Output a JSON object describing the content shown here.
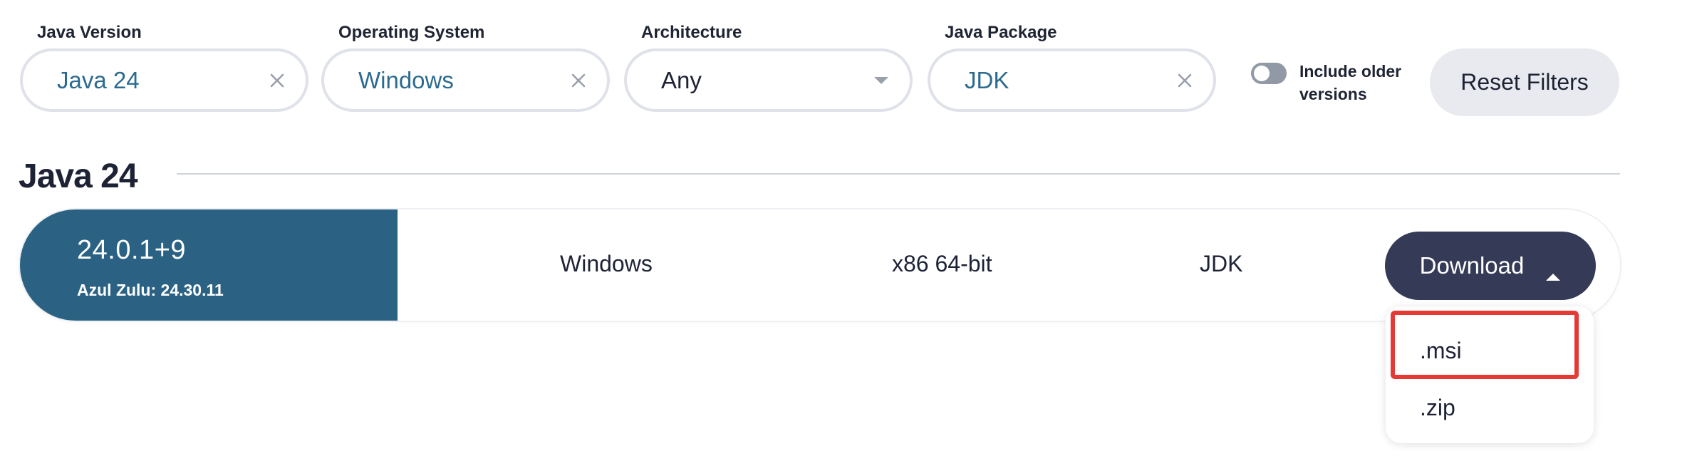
{
  "filters": {
    "java_version": {
      "label": "Java Version",
      "value": "Java 24"
    },
    "operating_system": {
      "label": "Operating System",
      "value": "Windows"
    },
    "architecture": {
      "label": "Architecture",
      "value": "Any"
    },
    "java_package": {
      "label": "Java Package",
      "value": "JDK"
    },
    "include_older": {
      "label": "Include older versions",
      "enabled": false
    },
    "reset_label": "Reset Filters"
  },
  "section": {
    "title": "Java 24"
  },
  "result": {
    "version": "24.0.1+9",
    "build": "Azul Zulu: 24.30.11",
    "os": "Windows",
    "arch": "x86 64-bit",
    "package": "JDK",
    "download_label": "Download"
  },
  "download_menu": {
    "items": [
      ".msi",
      ".zip"
    ],
    "highlighted_item": ".msi"
  },
  "colors": {
    "version_cell_bg": "#2b6283",
    "download_button_bg": "#353b57",
    "selected_value_text": "#2c6b8f",
    "highlight_border": "#e53935"
  }
}
